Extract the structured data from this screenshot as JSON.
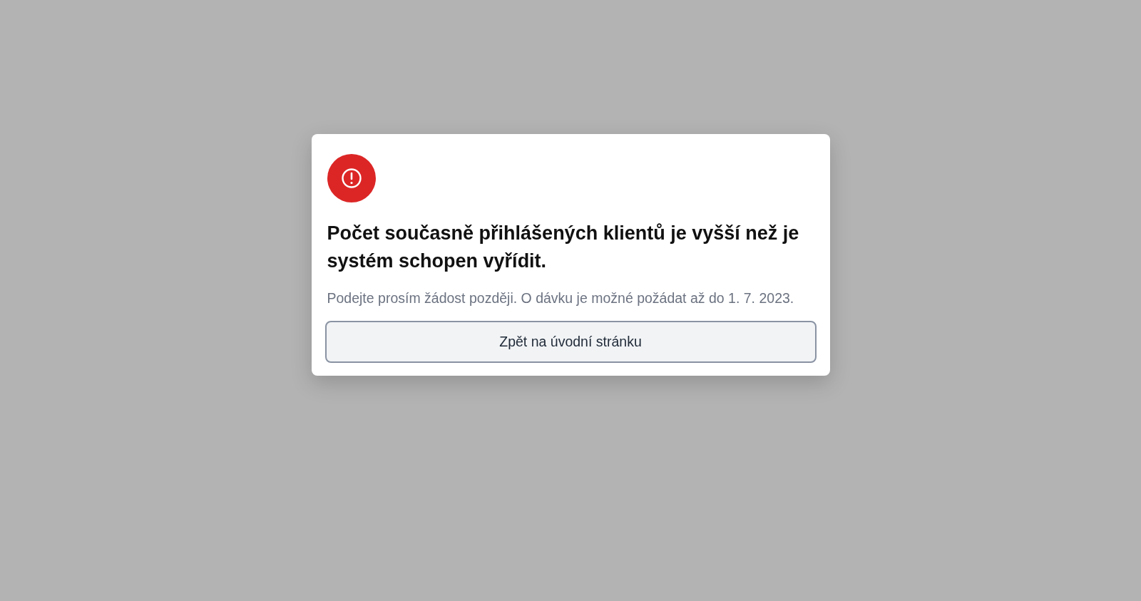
{
  "dialog": {
    "title": "Počet současně přihlášených klientů je vyšší než je systém schopen vyřídit.",
    "message": "Podejte prosím žádost později. O dávku je možné požádat až do 1. 7. 2023.",
    "button": "Zpět na úvodní stránku"
  }
}
